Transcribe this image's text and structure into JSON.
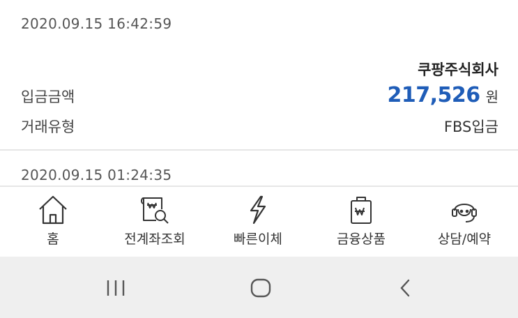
{
  "transactions": [
    {
      "datetime": "2020.09.15 16:42:59",
      "merchant": "쿠팡주식회사",
      "amount_label": "입금금액",
      "amount": "217,526",
      "currency": "원",
      "type_label": "거래유형",
      "type": "FBS입금"
    },
    {
      "datetime": "2020.09.15 01:24:35"
    }
  ],
  "tabbar": {
    "items": [
      {
        "label": "홈",
        "icon": "home-icon"
      },
      {
        "label": "전계좌조회",
        "icon": "account-search-icon"
      },
      {
        "label": "빠른이체",
        "icon": "lightning-icon"
      },
      {
        "label": "금융상품",
        "icon": "financial-product-icon"
      },
      {
        "label": "상담/예약",
        "icon": "headset-icon"
      }
    ]
  },
  "system_nav": {
    "buttons": [
      "recent-apps-icon",
      "home-button-icon",
      "back-icon"
    ]
  },
  "colors": {
    "amount": "#1f5db8",
    "navbar_bg": "#efefef",
    "divider": "#e6e6e6"
  }
}
